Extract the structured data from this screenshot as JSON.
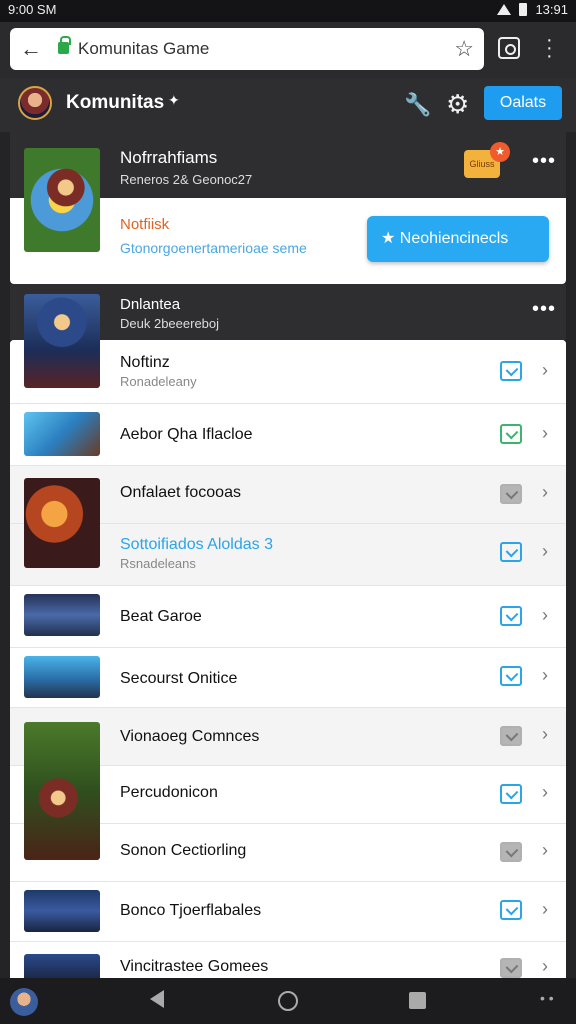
{
  "status_bar": {
    "time_left": "9:00 SM",
    "time_right": "13:91"
  },
  "browser": {
    "url": "Komunitas Game"
  },
  "header": {
    "title": "Komunitas",
    "title_mark": "✦",
    "button_label": "Oalats"
  },
  "featured": [
    {
      "name": "Nofrrahfiams",
      "subtitle": "Reneros 2& Geonoc27",
      "notice_title": "Notfiisk",
      "notice_subtitle": "Gtonorgoenertamerioae seme",
      "button_label": "Neohiencinecls",
      "badge_label": "Gliuss"
    },
    {
      "name": "Dnlantea",
      "subtitle": "Deuk 2beeereboj"
    }
  ],
  "games": [
    {
      "name": "Noftinz",
      "subtitle": "Ronadeleany",
      "check": "blue"
    },
    {
      "name": "Aebor Qha Iflacloe",
      "subtitle": "",
      "check": "green"
    },
    {
      "name": "Onfalaet focooas",
      "subtitle": "",
      "check": "grey"
    },
    {
      "name": "Sottoifiados Aloldas 3",
      "subtitle": "Rsnadeleans",
      "check": "blue"
    },
    {
      "name": "Beat Garoe",
      "subtitle": "",
      "check": "blue"
    },
    {
      "name": "Secourst Onitice",
      "subtitle": "",
      "check": "blue"
    },
    {
      "name": "Vionaoeg Comnces",
      "subtitle": "",
      "check": "grey"
    },
    {
      "name": "Percudonicon",
      "subtitle": "",
      "check": "blue"
    },
    {
      "name": "Sonon Cectiorling",
      "subtitle": "",
      "check": "grey"
    },
    {
      "name": "Bonco Tjoerflabales",
      "subtitle": "",
      "check": "blue"
    },
    {
      "name": "Vincitrastee Gomees",
      "subtitle": "",
      "check": "grey"
    }
  ],
  "icons": [
    "back-arrow-icon",
    "lock-icon",
    "star-icon",
    "tabs-icon",
    "menu-dots-icon",
    "wrench-icon",
    "gear-icon",
    "more-icon",
    "checkbox-icon",
    "chevron-right-icon"
  ],
  "colors": {
    "accent": "#1e9df0",
    "header_bg": "#2e2e31",
    "notice": "#e2621f"
  }
}
